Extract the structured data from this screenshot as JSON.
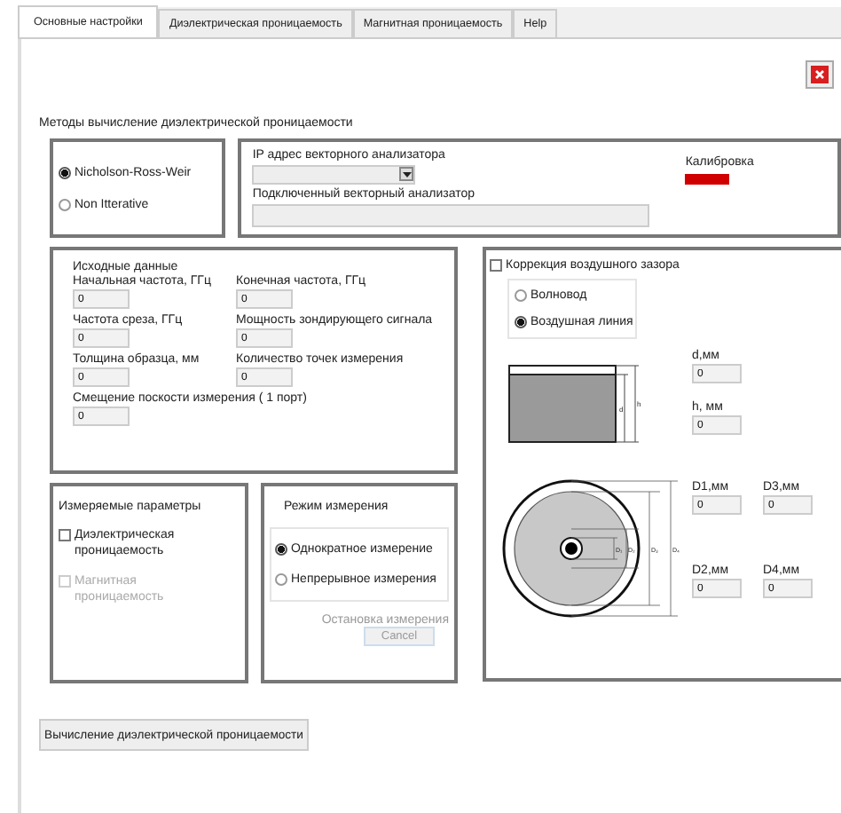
{
  "tabs": [
    {
      "label": "Основные настройки",
      "selected": true
    },
    {
      "label": "Диэлектрическая проницаемость",
      "selected": false
    },
    {
      "label": "Магнитная проницаемость",
      "selected": false
    },
    {
      "label": "Help",
      "selected": false
    }
  ],
  "methods": {
    "title": "Методы вычисление диэлектрической проницаемости",
    "options": [
      {
        "label": "Nicholson-Ross-Weir",
        "selected": true
      },
      {
        "label": "Non Itterative",
        "selected": false
      }
    ]
  },
  "analyzer": {
    "ip_label": "IP адрес векторного анализатора",
    "connected_label": "Подключенный векторный анализатор",
    "calibration_label": "Калибровка",
    "calibrated": false
  },
  "source_data": {
    "title": "Исходные данные",
    "fields": [
      {
        "label": "Начальная частота, ГГц",
        "value": "0"
      },
      {
        "label": "Конечная частота, ГГц",
        "value": "0"
      },
      {
        "label": "Частота среза, ГГц",
        "value": "0"
      },
      {
        "label": "Мощность зондирующего сигнала",
        "value": "0"
      },
      {
        "label": "Толщина образца, мм",
        "value": "0"
      },
      {
        "label": "Количество точек измерения",
        "value": "0"
      },
      {
        "label": "Смещение поскости измерения ( 1 порт)",
        "value": "0"
      }
    ]
  },
  "air_gap": {
    "label": "Коррекция воздушного зазора",
    "checked": false,
    "modes": [
      {
        "label": "Волновод",
        "selected": false
      },
      {
        "label": "Воздушная линия",
        "selected": true
      }
    ],
    "sample_labels": [
      "d",
      "h"
    ],
    "sample_fields": [
      {
        "label": "d,мм",
        "value": "0"
      },
      {
        "label": "h, мм",
        "value": "0"
      }
    ],
    "coax_labels": [
      "D₁",
      "D₂",
      "D₃",
      "D₄"
    ],
    "coax_fields": [
      {
        "label": "D1,мм",
        "value": "0"
      },
      {
        "label": "D3,мм",
        "value": "0"
      },
      {
        "label": "D2,мм",
        "value": "0"
      },
      {
        "label": "D4,мм",
        "value": "0"
      }
    ]
  },
  "measured": {
    "title": "Измеряемые параметры",
    "options": [
      {
        "label": "Диэлектрическая проницаемость",
        "checked": false,
        "disabled": false
      },
      {
        "label": "Магнитная проницаемость",
        "checked": false,
        "disabled": true
      }
    ]
  },
  "mode": {
    "title": "Режим измерения",
    "options": [
      {
        "label": "Однократное измерение",
        "selected": true
      },
      {
        "label": "Непрерывное измерения",
        "selected": false
      }
    ],
    "stop_label": "Остановка  измерения",
    "cancel": {
      "label": "Cancel",
      "disabled": true
    }
  },
  "calc_button": "Вычисление диэлектрической проницаемости"
}
